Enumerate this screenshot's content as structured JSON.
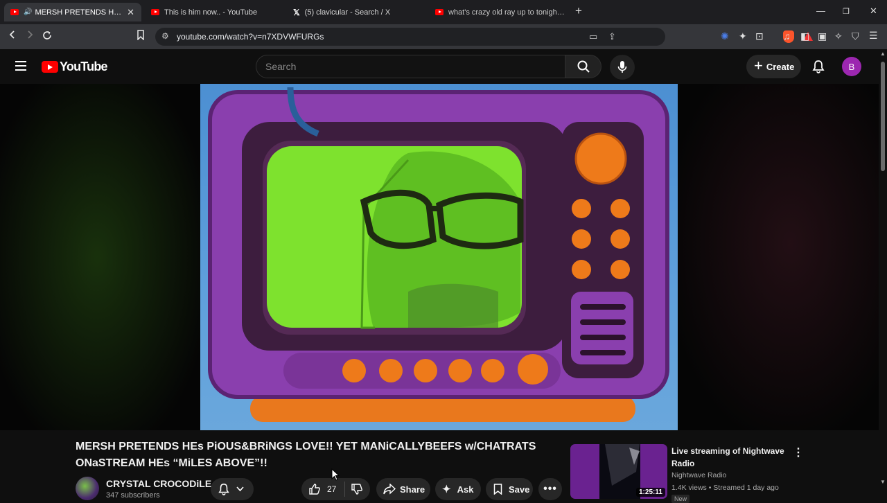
{
  "browser": {
    "tabs": [
      {
        "title": "MERSH PRETENDS HEs PiOUS&",
        "icon": "youtube-icon",
        "active": true
      },
      {
        "title": "This is him now.. - YouTube",
        "icon": "youtube-icon",
        "active": false
      },
      {
        "title": "(5) clavicular - Search / X",
        "icon": "x-icon",
        "active": false
      },
      {
        "title": "what's crazy old ray up to tonight? (g",
        "icon": "youtube-icon",
        "active": false
      }
    ],
    "url": "youtube.com/watch?v=n7XDVWFURGs"
  },
  "youtube": {
    "logo_text": "YouTube",
    "search_placeholder": "Search",
    "create_label": "Create",
    "avatar_letter": "B",
    "colors": {
      "brand": "#ff0000",
      "avatar": "#9c27b0"
    }
  },
  "video": {
    "title": "MERSH PRETENDS HEs PiOUS&BRiNGS LOVE!! YET MANiCALLYBEEFS w/CHATRATS ONaSTREAM HEs “MiLES ABOVE”!!",
    "channel": "CRYSTAL CROCODiLE",
    "subscribers": "347 subscribers",
    "likes": "27",
    "share_label": "Share",
    "ask_label": "Ask",
    "save_label": "Save"
  },
  "recommendation": {
    "title": "Live streaming of Nightwave Radio",
    "channel": "Nightwave Radio",
    "meta": "1.4K views • Streamed 1 day ago",
    "duration": "1:25:11",
    "badge": "New"
  }
}
